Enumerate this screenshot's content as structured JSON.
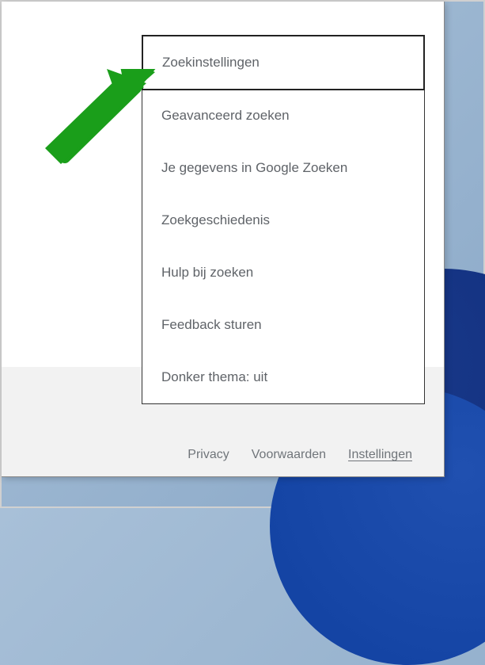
{
  "menu": {
    "items": [
      {
        "label": "Zoekinstellingen"
      },
      {
        "label": "Geavanceerd zoeken"
      },
      {
        "label": "Je gegevens in Google Zoeken"
      },
      {
        "label": "Zoekgeschiedenis"
      },
      {
        "label": "Hulp bij zoeken"
      },
      {
        "label": "Feedback sturen"
      },
      {
        "label": "Donker thema: uit"
      }
    ]
  },
  "footer": {
    "privacy": "Privacy",
    "terms": "Voorwaarden",
    "settings": "Instellingen"
  }
}
